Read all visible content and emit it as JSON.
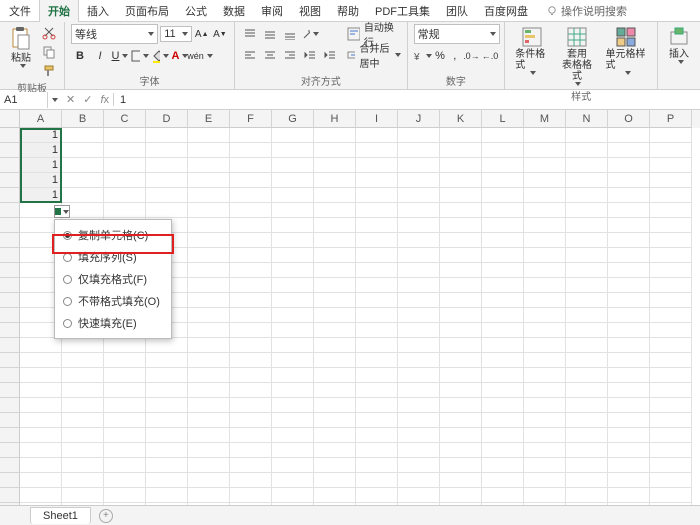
{
  "tabs": {
    "file": "文件",
    "home": "开始",
    "insert": "插入",
    "layout": "页面布局",
    "formula": "公式",
    "data": "数据",
    "review": "审阅",
    "view": "视图",
    "help": "帮助",
    "pdf": "PDF工具集",
    "team": "团队",
    "baidu": "百度网盘"
  },
  "help_hint": "操作说明搜索",
  "clipboard": {
    "label": "剪贴板",
    "paste": "粘贴"
  },
  "font": {
    "label": "字体",
    "family": "等线",
    "size": "11"
  },
  "align": {
    "label": "对齐方式",
    "wrap": "自动换行",
    "merge": "合并后居中"
  },
  "number": {
    "label": "数字",
    "format": "常规"
  },
  "styles": {
    "label": "样式",
    "cond": "条件格式",
    "table": "套用\n表格格式",
    "cell": "单元格样式"
  },
  "edit": {
    "insert": "插入"
  },
  "namebox": "A1",
  "formula_value": "1",
  "columns": [
    "A",
    "B",
    "C",
    "D",
    "E",
    "F",
    "G",
    "H",
    "I",
    "J",
    "K",
    "L",
    "M",
    "N",
    "O",
    "P"
  ],
  "selected_values": [
    "1",
    "1",
    "1",
    "1",
    "1"
  ],
  "fill_menu": {
    "copy": "复制单元格(C)",
    "series": "填充序列(S)",
    "fmt_only": "仅填充格式(F)",
    "no_fmt": "不带格式填充(O)",
    "flash": "快速填充(E)"
  },
  "sheet1": "Sheet1"
}
